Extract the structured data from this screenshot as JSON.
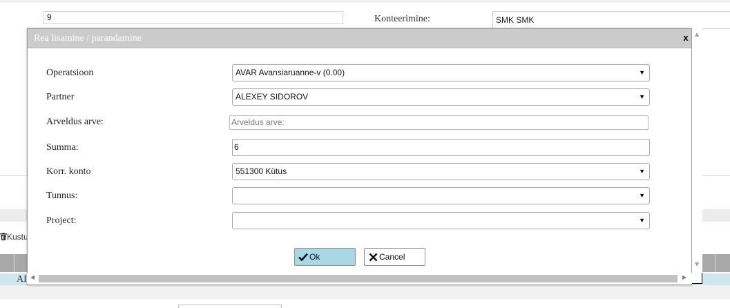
{
  "background": {
    "top_field_value": "9",
    "konteerimine_label": "Konteerimine:",
    "konteerimine_value": "SMK SMK",
    "toolbar_delete_label": "Kustu",
    "table_row_first_text": "AI"
  },
  "dialog": {
    "title": "Rea lisamine / parandamine",
    "close_label": "x",
    "fields": {
      "operatsioon": {
        "label": "Operatsioon",
        "value": "AVAR Avansiaruanne-v (0.00)"
      },
      "partner": {
        "label": "Partner",
        "value": "ALEXEY SIDOROV"
      },
      "arveldus": {
        "label": "Arveldus arve:",
        "placeholder": "Arveldus arve:"
      },
      "summa": {
        "label": "Summa:",
        "value": "6"
      },
      "korr_konto": {
        "label": "Korr. konto",
        "value": "551300 Kütus"
      },
      "tunnus": {
        "label": "Tunnus:",
        "value": ""
      },
      "project": {
        "label": "Project:",
        "value": ""
      }
    },
    "buttons": {
      "ok": "Ok",
      "cancel": "Cancel"
    }
  },
  "icons": {
    "dropdown": "triangle-down",
    "ok": "checkmark",
    "cancel": "x-mark",
    "delete": "trash"
  }
}
